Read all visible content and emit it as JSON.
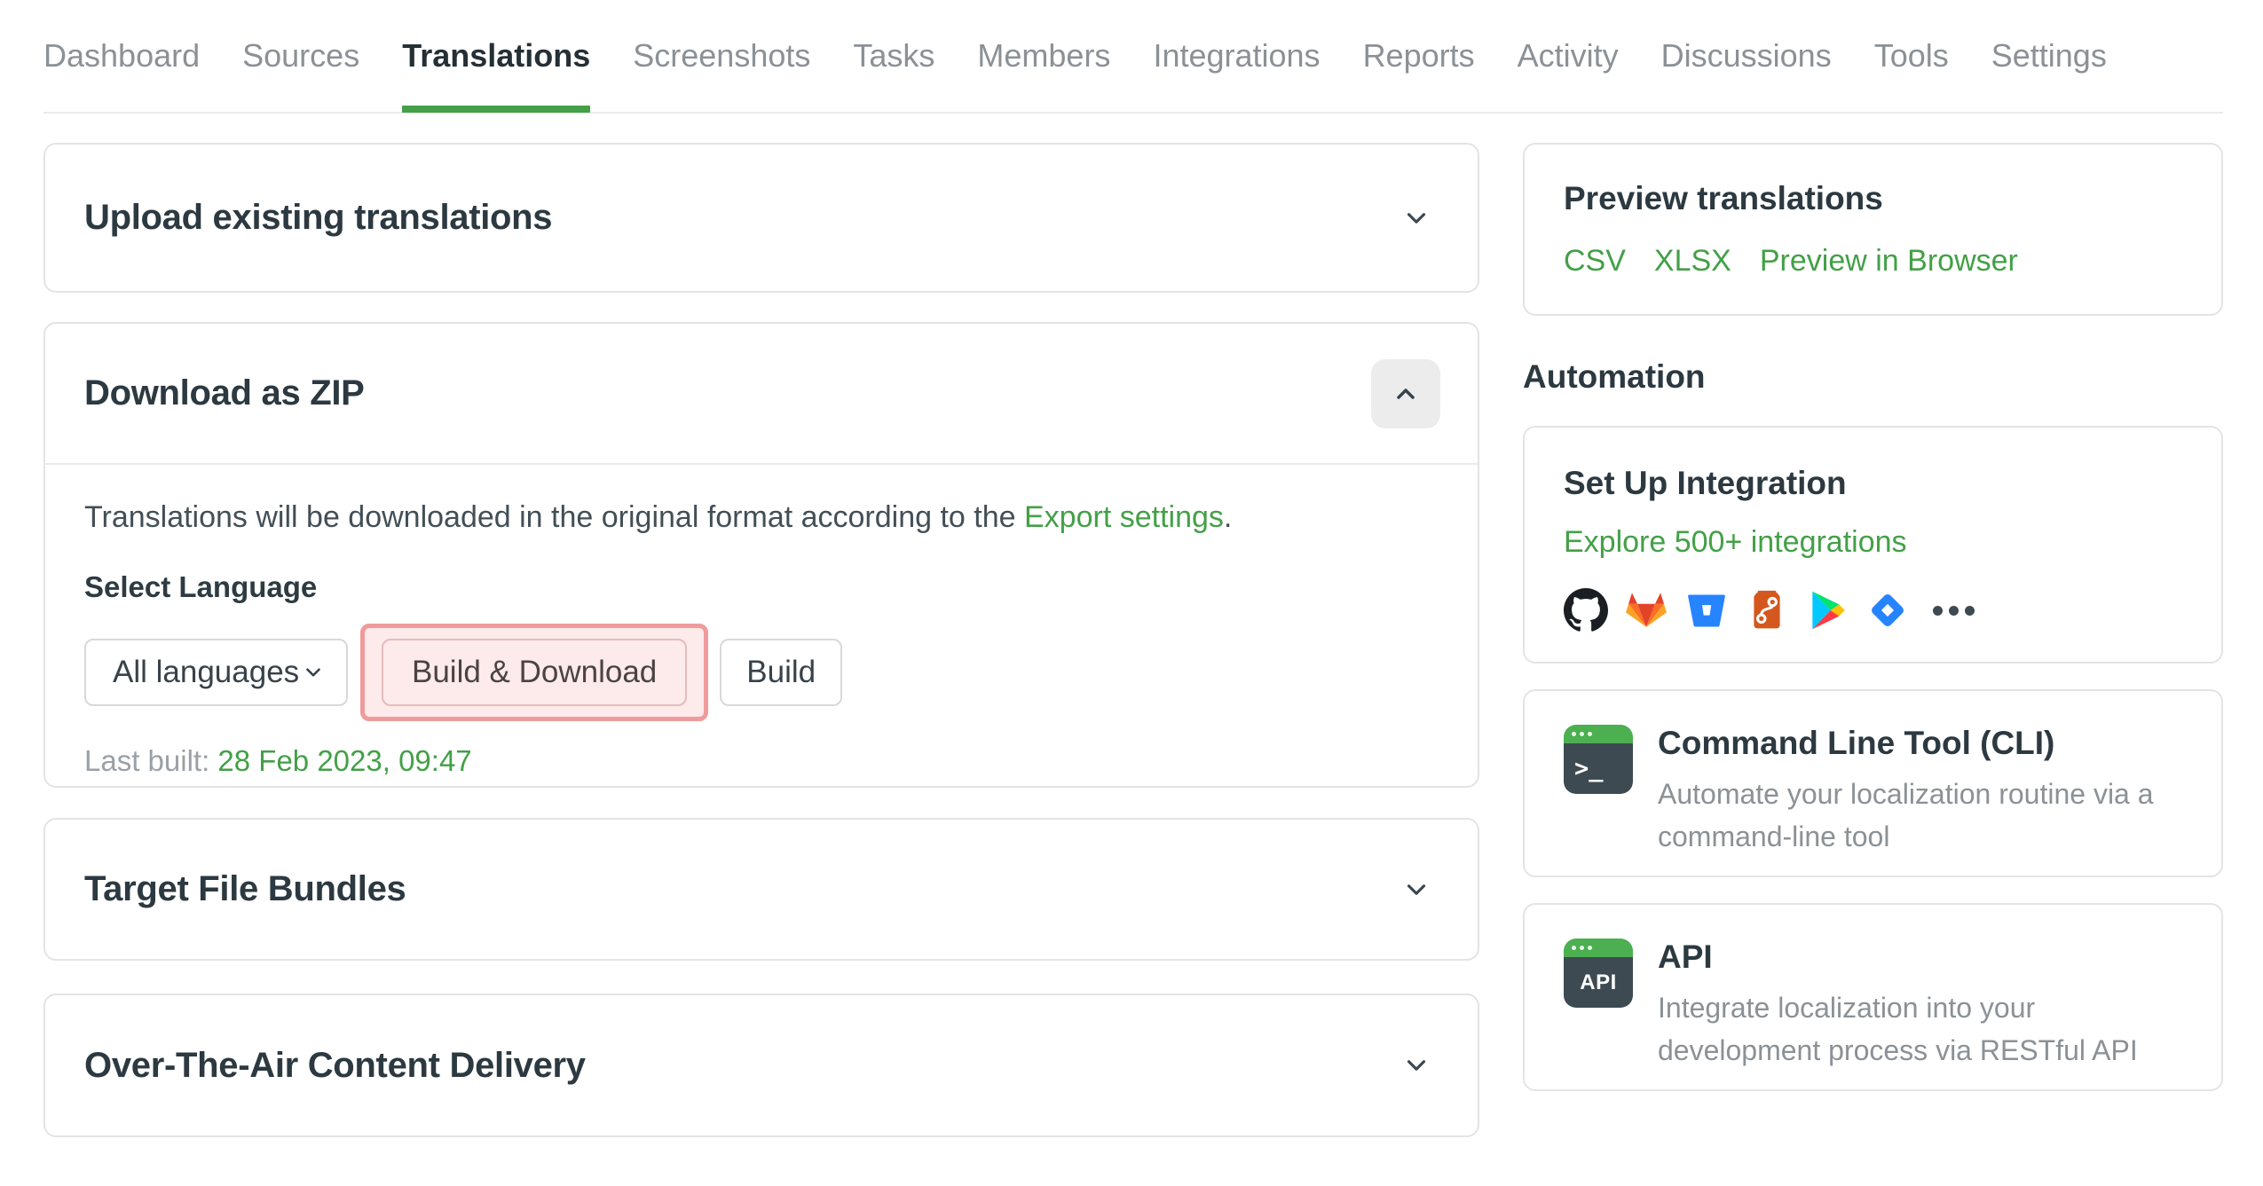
{
  "nav": {
    "items": [
      {
        "label": "Dashboard",
        "active": false
      },
      {
        "label": "Sources",
        "active": false
      },
      {
        "label": "Translations",
        "active": true
      },
      {
        "label": "Screenshots",
        "active": false
      },
      {
        "label": "Tasks",
        "active": false
      },
      {
        "label": "Members",
        "active": false
      },
      {
        "label": "Integrations",
        "active": false
      },
      {
        "label": "Reports",
        "active": false
      },
      {
        "label": "Activity",
        "active": false
      },
      {
        "label": "Discussions",
        "active": false
      },
      {
        "label": "Tools",
        "active": false
      },
      {
        "label": "Settings",
        "active": false
      }
    ]
  },
  "main": {
    "upload_panel": {
      "title": "Upload existing translations"
    },
    "download_panel": {
      "title": "Download as ZIP",
      "description_prefix": "Translations will be downloaded in the original format according to the ",
      "description_link": "Export settings",
      "description_suffix": ".",
      "select_language_label": "Select Language",
      "language_selected": "All languages",
      "build_download_button": "Build & Download",
      "build_button": "Build",
      "last_built_label": "Last built: ",
      "last_built_date": "28 Feb 2023, 09:47"
    },
    "bundles_panel": {
      "title": "Target File Bundles"
    },
    "ota_panel": {
      "title": "Over-The-Air Content Delivery"
    }
  },
  "sidebar": {
    "preview": {
      "title": "Preview translations",
      "links": [
        "CSV",
        "XLSX",
        "Preview in Browser"
      ]
    },
    "automation_heading": "Automation",
    "integration": {
      "title": "Set Up Integration",
      "link": "Explore 500+ integrations",
      "icons": [
        "github",
        "gitlab",
        "bitbucket",
        "git",
        "google-play",
        "jira",
        "more-integrations"
      ]
    },
    "cli": {
      "title": "Command Line Tool (CLI)",
      "description": "Automate your localization routine via a command-line tool",
      "icon_text": ">_"
    },
    "api": {
      "title": "API",
      "description": "Integrate localization into your development process via RESTful API",
      "icon_text": "API"
    }
  },
  "colors": {
    "accent_green": "#43a047",
    "highlight_border": "#f09b9b",
    "highlight_bg": "#fdeaea",
    "nav_inactive": "#8b9196",
    "heading_dark": "#2c3940"
  }
}
